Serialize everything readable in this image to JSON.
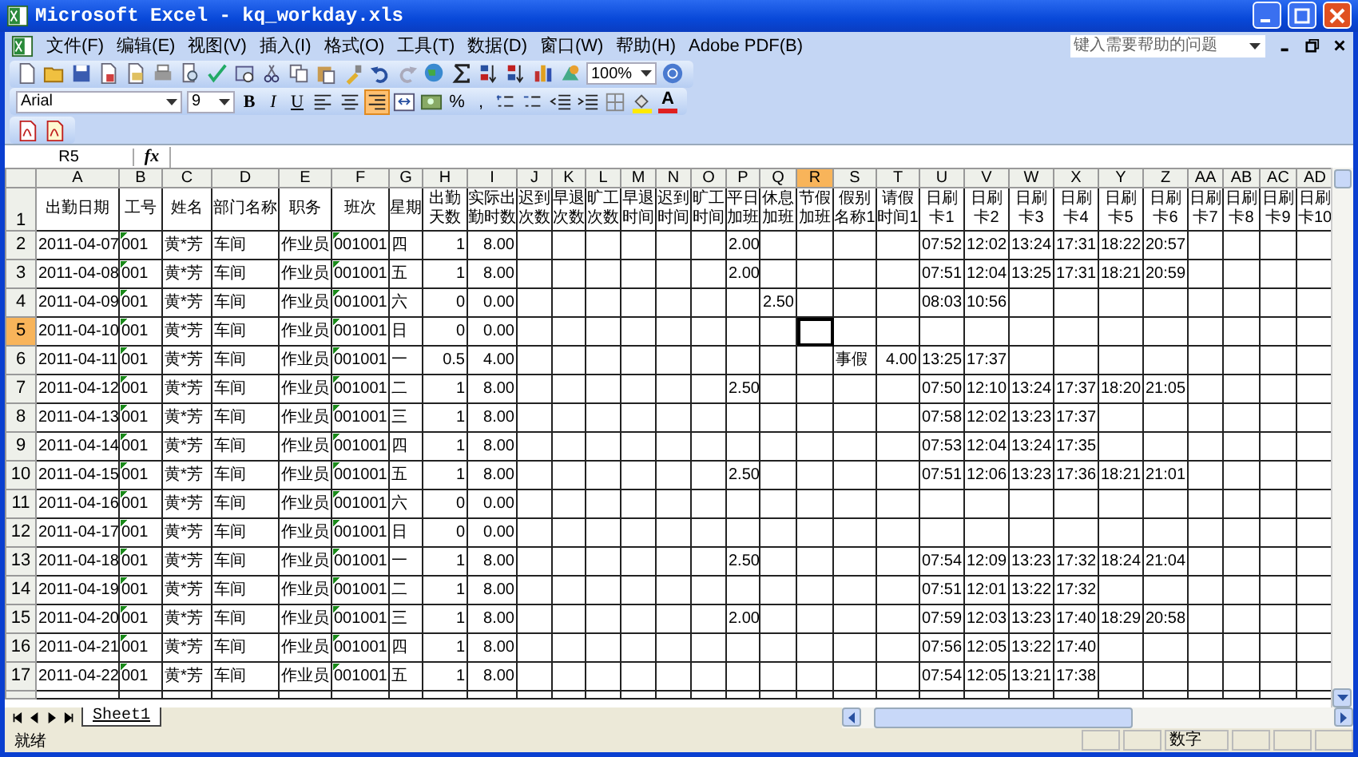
{
  "window": {
    "title": "Microsoft Excel - kq_workday.xls"
  },
  "menu": [
    "文件(F)",
    "编辑(E)",
    "视图(V)",
    "插入(I)",
    "格式(O)",
    "工具(T)",
    "数据(D)",
    "窗口(W)",
    "帮助(H)",
    "Adobe PDF(B)"
  ],
  "help_box": {
    "placeholder": "键入需要帮助的问题"
  },
  "standard_toolbar": {
    "zoom": "100%"
  },
  "format_toolbar": {
    "font": "Arial",
    "size": "9",
    "bold": "B",
    "italic": "I",
    "underline": "U",
    "align_buttons": [
      {
        "selected": false
      },
      {
        "selected": false
      },
      {
        "selected": true
      }
    ],
    "percent": "%",
    "comma": ",",
    "font_color": "A"
  },
  "formula_bar": {
    "name_box": "R5",
    "fx": "fx"
  },
  "sheet": {
    "columns": [
      {
        "letter": "A",
        "heading": "出勤日期",
        "kind": "text",
        "selected": false
      },
      {
        "letter": "B",
        "heading": "工号",
        "kind": "code",
        "selected": false
      },
      {
        "letter": "C",
        "heading": "姓名",
        "kind": "text",
        "selected": false
      },
      {
        "letter": "D",
        "heading": "部门名称",
        "kind": "text",
        "selected": false
      },
      {
        "letter": "E",
        "heading": "职务",
        "kind": "text",
        "selected": false
      },
      {
        "letter": "F",
        "heading": "班次",
        "kind": "code",
        "selected": false
      },
      {
        "letter": "G",
        "heading": "星期",
        "kind": "text",
        "selected": false
      },
      {
        "letter": "H",
        "heading": "出勤天数",
        "kind": "number",
        "selected": false
      },
      {
        "letter": "I",
        "heading": "实际出勤时数",
        "kind": "number",
        "selected": false
      },
      {
        "letter": "J",
        "heading": "迟到次数",
        "kind": "number",
        "selected": false
      },
      {
        "letter": "K",
        "heading": "早退次数",
        "kind": "number",
        "selected": false
      },
      {
        "letter": "L",
        "heading": "旷工次数",
        "kind": "number",
        "selected": false
      },
      {
        "letter": "M",
        "heading": "早退时间",
        "kind": "number",
        "selected": false
      },
      {
        "letter": "N",
        "heading": "迟到时间",
        "kind": "number",
        "selected": false
      },
      {
        "letter": "O",
        "heading": "旷工时间",
        "kind": "number",
        "selected": false
      },
      {
        "letter": "P",
        "heading": "平日加班",
        "kind": "number",
        "selected": false
      },
      {
        "letter": "Q",
        "heading": "休息加班",
        "kind": "number",
        "selected": false
      },
      {
        "letter": "R",
        "heading": "节假加班",
        "kind": "number",
        "selected": true
      },
      {
        "letter": "S",
        "heading": "假别名称1",
        "kind": "text",
        "selected": false
      },
      {
        "letter": "T",
        "heading": "请假时间1",
        "kind": "number",
        "selected": false
      },
      {
        "letter": "U",
        "heading": "日刷卡1",
        "kind": "text",
        "selected": false
      },
      {
        "letter": "V",
        "heading": "日刷卡2",
        "kind": "text",
        "selected": false
      },
      {
        "letter": "W",
        "heading": "日刷卡3",
        "kind": "text",
        "selected": false
      },
      {
        "letter": "X",
        "heading": "日刷卡4",
        "kind": "text",
        "selected": false
      },
      {
        "letter": "Y",
        "heading": "日刷卡5",
        "kind": "text",
        "selected": false
      },
      {
        "letter": "Z",
        "heading": "日刷卡6",
        "kind": "text",
        "selected": false
      },
      {
        "letter": "AA",
        "heading": "日刷卡7",
        "kind": "text",
        "selected": false
      },
      {
        "letter": "AB",
        "heading": "日刷卡8",
        "kind": "text",
        "selected": false
      },
      {
        "letter": "AC",
        "heading": "日刷卡9",
        "kind": "text",
        "selected": false
      },
      {
        "letter": "AD",
        "heading": "日刷卡10",
        "kind": "text",
        "selected": false
      }
    ],
    "heading_row": {
      "number": "1",
      "selected": false
    },
    "rows": [
      {
        "number": "2",
        "selected": false,
        "cells": {
          "A": "2011-04-07",
          "B": "001",
          "C": "黄*芳",
          "D": "车间",
          "E": "作业员",
          "F": "001001",
          "G": "四",
          "H": "1",
          "I": "8.00",
          "P": "2.00",
          "U": "07:52",
          "V": "12:02",
          "W": "13:24",
          "X": "17:31",
          "Y": "18:22",
          "Z": "20:57"
        }
      },
      {
        "number": "3",
        "selected": false,
        "cells": {
          "A": "2011-04-08",
          "B": "001",
          "C": "黄*芳",
          "D": "车间",
          "E": "作业员",
          "F": "001001",
          "G": "五",
          "H": "1",
          "I": "8.00",
          "P": "2.00",
          "U": "07:51",
          "V": "12:04",
          "W": "13:25",
          "X": "17:31",
          "Y": "18:21",
          "Z": "20:59"
        }
      },
      {
        "number": "4",
        "selected": false,
        "cells": {
          "A": "2011-04-09",
          "B": "001",
          "C": "黄*芳",
          "D": "车间",
          "E": "作业员",
          "F": "001001",
          "G": "六",
          "H": "0",
          "I": "0.00",
          "Q": "2.50",
          "U": "08:03",
          "V": "10:56"
        }
      },
      {
        "number": "5",
        "selected": true,
        "cells": {
          "A": "2011-04-10",
          "B": "001",
          "C": "黄*芳",
          "D": "车间",
          "E": "作业员",
          "F": "001001",
          "G": "日",
          "H": "0",
          "I": "0.00"
        }
      },
      {
        "number": "6",
        "selected": false,
        "cells": {
          "A": "2011-04-11",
          "B": "001",
          "C": "黄*芳",
          "D": "车间",
          "E": "作业员",
          "F": "001001",
          "G": "一",
          "H": "0.5",
          "I": "4.00",
          "S": "事假",
          "T": "4.00",
          "U": "13:25",
          "V": "17:37"
        }
      },
      {
        "number": "7",
        "selected": false,
        "cells": {
          "A": "2011-04-12",
          "B": "001",
          "C": "黄*芳",
          "D": "车间",
          "E": "作业员",
          "F": "001001",
          "G": "二",
          "H": "1",
          "I": "8.00",
          "P": "2.50",
          "U": "07:50",
          "V": "12:10",
          "W": "13:24",
          "X": "17:37",
          "Y": "18:20",
          "Z": "21:05"
        }
      },
      {
        "number": "8",
        "selected": false,
        "cells": {
          "A": "2011-04-13",
          "B": "001",
          "C": "黄*芳",
          "D": "车间",
          "E": "作业员",
          "F": "001001",
          "G": "三",
          "H": "1",
          "I": "8.00",
          "U": "07:58",
          "V": "12:02",
          "W": "13:23",
          "X": "17:37"
        }
      },
      {
        "number": "9",
        "selected": false,
        "cells": {
          "A": "2011-04-14",
          "B": "001",
          "C": "黄*芳",
          "D": "车间",
          "E": "作业员",
          "F": "001001",
          "G": "四",
          "H": "1",
          "I": "8.00",
          "U": "07:53",
          "V": "12:04",
          "W": "13:24",
          "X": "17:35"
        }
      },
      {
        "number": "10",
        "selected": false,
        "cells": {
          "A": "2011-04-15",
          "B": "001",
          "C": "黄*芳",
          "D": "车间",
          "E": "作业员",
          "F": "001001",
          "G": "五",
          "H": "1",
          "I": "8.00",
          "P": "2.50",
          "U": "07:51",
          "V": "12:06",
          "W": "13:23",
          "X": "17:36",
          "Y": "18:21",
          "Z": "21:01"
        }
      },
      {
        "number": "11",
        "selected": false,
        "cells": {
          "A": "2011-04-16",
          "B": "001",
          "C": "黄*芳",
          "D": "车间",
          "E": "作业员",
          "F": "001001",
          "G": "六",
          "H": "0",
          "I": "0.00"
        }
      },
      {
        "number": "12",
        "selected": false,
        "cells": {
          "A": "2011-04-17",
          "B": "001",
          "C": "黄*芳",
          "D": "车间",
          "E": "作业员",
          "F": "001001",
          "G": "日",
          "H": "0",
          "I": "0.00"
        }
      },
      {
        "number": "13",
        "selected": false,
        "cells": {
          "A": "2011-04-18",
          "B": "001",
          "C": "黄*芳",
          "D": "车间",
          "E": "作业员",
          "F": "001001",
          "G": "一",
          "H": "1",
          "I": "8.00",
          "P": "2.50",
          "U": "07:54",
          "V": "12:09",
          "W": "13:23",
          "X": "17:32",
          "Y": "18:24",
          "Z": "21:04"
        }
      },
      {
        "number": "14",
        "selected": false,
        "cells": {
          "A": "2011-04-19",
          "B": "001",
          "C": "黄*芳",
          "D": "车间",
          "E": "作业员",
          "F": "001001",
          "G": "二",
          "H": "1",
          "I": "8.00",
          "U": "07:51",
          "V": "12:01",
          "W": "13:22",
          "X": "17:32"
        }
      },
      {
        "number": "15",
        "selected": false,
        "cells": {
          "A": "2011-04-20",
          "B": "001",
          "C": "黄*芳",
          "D": "车间",
          "E": "作业员",
          "F": "001001",
          "G": "三",
          "H": "1",
          "I": "8.00",
          "P": "2.00",
          "U": "07:59",
          "V": "12:03",
          "W": "13:23",
          "X": "17:40",
          "Y": "18:29",
          "Z": "20:58"
        }
      },
      {
        "number": "16",
        "selected": false,
        "cells": {
          "A": "2011-04-21",
          "B": "001",
          "C": "黄*芳",
          "D": "车间",
          "E": "作业员",
          "F": "001001",
          "G": "四",
          "H": "1",
          "I": "8.00",
          "U": "07:56",
          "V": "12:05",
          "W": "13:22",
          "X": "17:40"
        }
      },
      {
        "number": "17",
        "selected": false,
        "cells": {
          "A": "2011-04-22",
          "B": "001",
          "C": "黄*芳",
          "D": "车间",
          "E": "作业员",
          "F": "001001",
          "G": "五",
          "H": "1",
          "I": "8.00",
          "U": "07:54",
          "V": "12:05",
          "W": "13:21",
          "X": "17:38"
        }
      }
    ]
  },
  "sheet_tabs": [
    {
      "label": "Sheet1",
      "selected": true
    }
  ],
  "status_bar": {
    "left": "就绪",
    "mode": "数字"
  }
}
